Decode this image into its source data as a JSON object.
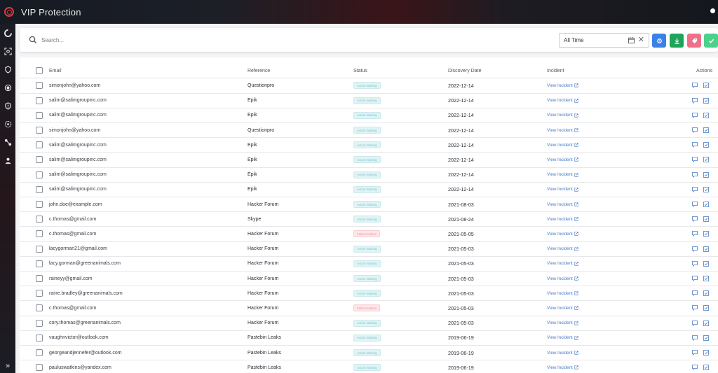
{
  "app": {
    "title": "VIP Protection"
  },
  "sidebar": {
    "icons": [
      "dashboard-icon",
      "scan-icon",
      "hand-shield-icon",
      "shield-icon",
      "alert-shield-icon",
      "settings-shield-icon",
      "network-icon",
      "user-shield-icon"
    ],
    "expand_icon": "»"
  },
  "search": {
    "placeholder": "Search..."
  },
  "filter": {
    "value": "All Time"
  },
  "toolbar": {
    "buttons": [
      {
        "name": "settings",
        "color": "#3b82e6"
      },
      {
        "name": "download",
        "color": "#1ea55b"
      },
      {
        "name": "tag",
        "color": "#ef7189"
      },
      {
        "name": "confirm",
        "color": "#4cd18a"
      }
    ]
  },
  "table": {
    "headers": {
      "email": "Email",
      "reference": "Reference",
      "status": "Status",
      "discovery_date": "Discovery Date",
      "incident": "Incident",
      "actions": "Actions"
    },
    "link_label": "View Incident",
    "rows": [
      {
        "email": "simonjohn@yahoo.com",
        "reference": "Questionpro",
        "status": "Action Waiting",
        "date": "2022-12-14",
        "incident": "View Incident"
      },
      {
        "email": "salim@salimgroupinc.com",
        "reference": "Epik",
        "status": "Action Waiting",
        "date": "2022-12-14",
        "incident": "View Incident"
      },
      {
        "email": "salim@salimgroupinc.com",
        "reference": "Epik",
        "status": "Action Waiting",
        "date": "2022-12-14",
        "incident": "View Incident"
      },
      {
        "email": "simonjohn@yahoo.com",
        "reference": "Questionpro",
        "status": "Action Waiting",
        "date": "2022-12-14",
        "incident": "View Incident"
      },
      {
        "email": "salim@salimgroupinc.com",
        "reference": "Epik",
        "status": "Action Waiting",
        "date": "2022-12-14",
        "incident": "View Incident"
      },
      {
        "email": "salim@salimgroupinc.com",
        "reference": "Epik",
        "status": "Action Waiting",
        "date": "2022-12-14",
        "incident": "View Incident"
      },
      {
        "email": "salim@salimgroupinc.com",
        "reference": "Epik",
        "status": "Action Waiting",
        "date": "2022-12-14",
        "incident": "View Incident"
      },
      {
        "email": "salim@salimgroupinc.com",
        "reference": "Epik",
        "status": "Action Waiting",
        "date": "2022-12-14",
        "incident": "View Incident"
      },
      {
        "email": "john.doe@example.com",
        "reference": "Hacker Forum",
        "status": "Action Waiting",
        "date": "2021-08-03",
        "incident": "View Incident"
      },
      {
        "email": "c.thomas@gmail.com",
        "reference": "Skype",
        "status": "Action Waiting",
        "date": "2021-08-24",
        "incident": "View Incident"
      },
      {
        "email": "c.thomas@gmail.com",
        "reference": "Hacker Forum",
        "status": "False Positive",
        "date": "2021-05-05",
        "incident": "View Incident"
      },
      {
        "email": "lacygorman21@gmail.com",
        "reference": "Hacker Forum",
        "status": "Action Waiting",
        "date": "2021-05-03",
        "incident": "View Incident"
      },
      {
        "email": "lacy.gorman@greenanimals.com",
        "reference": "Hacker Forum",
        "status": "Action Waiting",
        "date": "2021-05-03",
        "incident": "View Incident"
      },
      {
        "email": "raineyy@gmail.com",
        "reference": "Hacker Forum",
        "status": "Action Waiting",
        "date": "2021-05-03",
        "incident": "View Incident"
      },
      {
        "email": "raine.bradley@greenanimals.com",
        "reference": "Hacker Forum",
        "status": "Action Waiting",
        "date": "2021-05-03",
        "incident": "View Incident"
      },
      {
        "email": "c.thomas@gmail.com",
        "reference": "Hacker Forum",
        "status": "False Positive",
        "date": "2021-05-03",
        "incident": "View Incident"
      },
      {
        "email": "cory.thomas@greenanimals.com",
        "reference": "Hacker Forum",
        "status": "Action Waiting",
        "date": "2021-05-03",
        "incident": "View Incident"
      },
      {
        "email": "vaughnvictor@outlook.com",
        "reference": "Pastebin Leaks",
        "status": "Action Waiting",
        "date": "2019-06-19",
        "incident": "View Incident"
      },
      {
        "email": "georgeandjennefer@outlook.com",
        "reference": "Pastebin Leaks",
        "status": "Action Waiting",
        "date": "2019-06-19",
        "incident": "View Incident"
      },
      {
        "email": "pauluswatkins@yandex.com",
        "reference": "Pastebin Leaks",
        "status": "Action Waiting",
        "date": "2019-06-19",
        "incident": "View Incident"
      }
    ]
  }
}
